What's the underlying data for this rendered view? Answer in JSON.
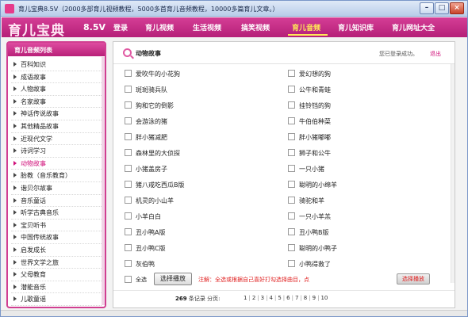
{
  "window": {
    "title": "育儿宝典8.5V（2000多部育儿视频教程，5000多首育儿音频教程，10000多篇育儿文章。）"
  },
  "nav": {
    "logo": "育儿宝典",
    "version": "8.5V",
    "items": [
      "登录",
      "育儿视频",
      "生活视频",
      "搞笑视频",
      "育儿音频",
      "育儿知识库",
      "育儿网址大全"
    ],
    "active_index": 4
  },
  "sidebar": {
    "header": "育儿音频列表",
    "items": [
      "百科知识",
      "成语故事",
      "人物故事",
      "名家故事",
      "神话传说故事",
      "其他精品故事",
      "近现代文学",
      "诗词学习",
      "动物故事",
      "胎教（音乐教育）",
      "谐贝尔故事",
      "音乐童话",
      "听学古典音乐",
      "宝贝听书",
      "中国传统故事",
      "启发成长",
      "世界文学之旅",
      "父母教育",
      "潜能音乐",
      "儿歌童谣"
    ],
    "active_index": 8
  },
  "content": {
    "category_title": "动物故事",
    "login_status": "您已登录成功。",
    "logout": "退出",
    "rows": [
      [
        "爱吹牛的小花狗",
        "爱幻想的狗"
      ],
      [
        "斑斑骑兵队",
        "公牛和青蛙"
      ],
      [
        "狗和它的倒影",
        "挂铃铛的狗"
      ],
      [
        "会游泳的猪",
        "牛伯伯种菜"
      ],
      [
        "胖小猪减肥",
        "胖小猪嘟嘟"
      ],
      [
        "森林里的大侦探",
        "狮子和公牛"
      ],
      [
        "小猪盖房子",
        "一只小猪"
      ],
      [
        "猪八戒吃西瓜B版",
        "聪明的小绵羊"
      ],
      [
        "机灵的小山羊",
        "骑驼和羊"
      ],
      [
        "小羊白白",
        "一只小羊羔"
      ],
      [
        "丑小鸭A版",
        "丑小鸭B版"
      ],
      [
        "丑小鸭C版",
        "聪明的小鸭子"
      ],
      [
        "灰伯鸭",
        "小鸭得救了"
      ]
    ],
    "select_all": "全选",
    "play_button": "选择播放",
    "tip": "注解：全选或根据自己喜好打勾选择曲目，点",
    "play_small": "选择播放"
  },
  "pager": {
    "total": "269",
    "records_label": "条记录",
    "pages_label": "分页:",
    "pages": [
      "1",
      "2",
      "3",
      "4",
      "5",
      "6",
      "7",
      "8",
      "9",
      "10"
    ]
  }
}
